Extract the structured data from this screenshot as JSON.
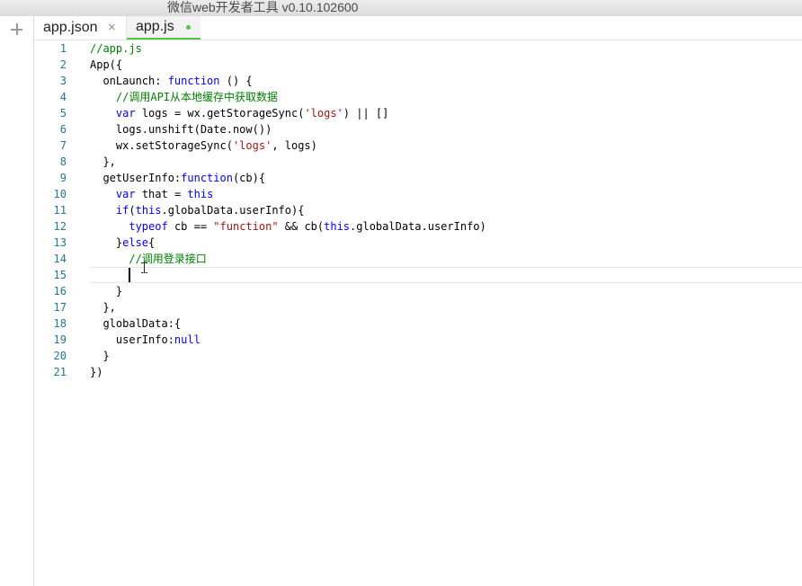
{
  "window": {
    "title": "微信web开发者工具 v0.10.102600"
  },
  "tabs": [
    {
      "label": "app.json",
      "close_icon": "×",
      "active": false,
      "modified": false
    },
    {
      "label": "app.js",
      "active": true,
      "modified": true
    }
  ],
  "icons": {
    "add": "plus-icon",
    "close": "close-icon",
    "modified": "dot-icon",
    "mouse": "text-cursor-icon"
  },
  "colors": {
    "line_number": "#237893",
    "keyword": "#0000ff",
    "comment": "#008000",
    "string": "#a31515",
    "active_tab_indicator": "#58c14b"
  },
  "editor": {
    "current_line": 15,
    "lines": [
      {
        "n": "1",
        "tokens": [
          {
            "t": "//app.js",
            "k": "comment"
          }
        ]
      },
      {
        "n": "2",
        "tokens": [
          {
            "t": "App({",
            "k": "plain"
          }
        ]
      },
      {
        "n": "3",
        "tokens": [
          {
            "t": "  onLaunch: ",
            "k": "plain"
          },
          {
            "t": "function",
            "k": "keyword"
          },
          {
            "t": " () {",
            "k": "plain"
          }
        ]
      },
      {
        "n": "4",
        "tokens": [
          {
            "t": "    //调用API从本地缓存中获取数据",
            "k": "comment"
          }
        ]
      },
      {
        "n": "5",
        "tokens": [
          {
            "t": "    ",
            "k": "plain"
          },
          {
            "t": "var",
            "k": "keyword"
          },
          {
            "t": " logs = wx.getStorageSync(",
            "k": "plain"
          },
          {
            "t": "'logs'",
            "k": "string"
          },
          {
            "t": ") || []",
            "k": "plain"
          }
        ]
      },
      {
        "n": "6",
        "tokens": [
          {
            "t": "    logs.unshift(Date.now())",
            "k": "plain"
          }
        ]
      },
      {
        "n": "7",
        "tokens": [
          {
            "t": "    wx.setStorageSync(",
            "k": "plain"
          },
          {
            "t": "'logs'",
            "k": "string"
          },
          {
            "t": ", logs)",
            "k": "plain"
          }
        ]
      },
      {
        "n": "8",
        "tokens": [
          {
            "t": "  },",
            "k": "plain"
          }
        ]
      },
      {
        "n": "9",
        "tokens": [
          {
            "t": "  getUserInfo:",
            "k": "plain"
          },
          {
            "t": "function",
            "k": "keyword"
          },
          {
            "t": "(cb){",
            "k": "plain"
          }
        ]
      },
      {
        "n": "10",
        "tokens": [
          {
            "t": "    ",
            "k": "plain"
          },
          {
            "t": "var",
            "k": "keyword"
          },
          {
            "t": " that = ",
            "k": "plain"
          },
          {
            "t": "this",
            "k": "keyword"
          }
        ]
      },
      {
        "n": "11",
        "tokens": [
          {
            "t": "    ",
            "k": "plain"
          },
          {
            "t": "if",
            "k": "keyword"
          },
          {
            "t": "(",
            "k": "plain"
          },
          {
            "t": "this",
            "k": "keyword"
          },
          {
            "t": ".globalData.userInfo){",
            "k": "plain"
          }
        ]
      },
      {
        "n": "12",
        "tokens": [
          {
            "t": "      ",
            "k": "plain"
          },
          {
            "t": "typeof",
            "k": "keyword"
          },
          {
            "t": " cb == ",
            "k": "plain"
          },
          {
            "t": "\"function\"",
            "k": "string"
          },
          {
            "t": " && cb(",
            "k": "plain"
          },
          {
            "t": "this",
            "k": "keyword"
          },
          {
            "t": ".globalData.userInfo)",
            "k": "plain"
          }
        ]
      },
      {
        "n": "13",
        "tokens": [
          {
            "t": "    }",
            "k": "plain"
          },
          {
            "t": "else",
            "k": "keyword"
          },
          {
            "t": "{",
            "k": "plain"
          }
        ]
      },
      {
        "n": "14",
        "tokens": [
          {
            "t": "      //调用登录接口",
            "k": "comment"
          }
        ]
      },
      {
        "n": "15",
        "tokens": [
          {
            "t": "",
            "k": "plain"
          }
        ]
      },
      {
        "n": "16",
        "tokens": [
          {
            "t": "    }",
            "k": "plain"
          }
        ]
      },
      {
        "n": "17",
        "tokens": [
          {
            "t": "  },",
            "k": "plain"
          }
        ]
      },
      {
        "n": "18",
        "tokens": [
          {
            "t": "  globalData:{",
            "k": "plain"
          }
        ]
      },
      {
        "n": "19",
        "tokens": [
          {
            "t": "    userInfo:",
            "k": "plain"
          },
          {
            "t": "null",
            "k": "keyword"
          }
        ]
      },
      {
        "n": "20",
        "tokens": [
          {
            "t": "  }",
            "k": "plain"
          }
        ]
      },
      {
        "n": "21",
        "tokens": [
          {
            "t": "})",
            "k": "plain"
          }
        ]
      }
    ]
  }
}
